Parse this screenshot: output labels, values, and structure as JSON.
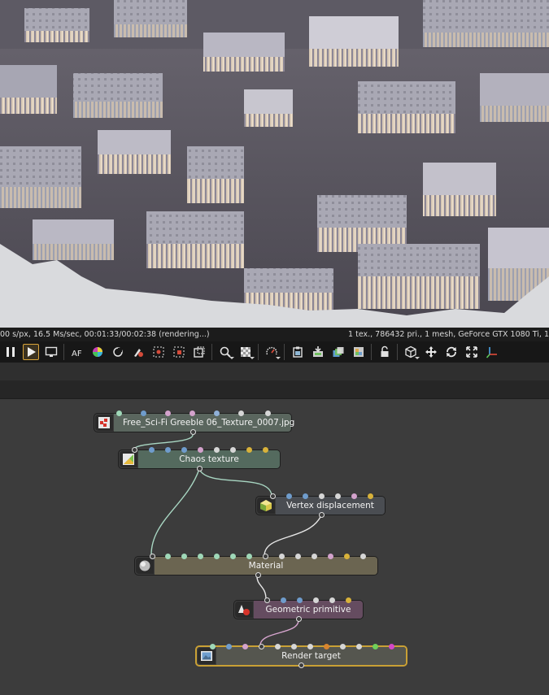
{
  "status": {
    "left": "00 s/px, 16.5 Ms/sec, 00:01:33/00:02:38 (rendering...)",
    "right": "1 tex., 786432 pri., 1 mesh, GeForce GTX 1080 Ti, 1"
  },
  "toolbar": {
    "buttons": [
      {
        "name": "pause-icon"
      },
      {
        "name": "play-icon",
        "active": true
      },
      {
        "name": "monitor-icon"
      },
      {
        "name": "af-focus-icon",
        "label": "AF"
      },
      {
        "name": "color-wheel-icon"
      },
      {
        "name": "white-balance-icon"
      },
      {
        "name": "material-picker-icon"
      },
      {
        "name": "object-picker-icon"
      },
      {
        "name": "camera-target-icon"
      },
      {
        "name": "region-render-icon"
      },
      {
        "name": "zoom-region-icon"
      },
      {
        "name": "film-region-icon"
      },
      {
        "name": "render-priority-icon"
      },
      {
        "name": "copy-to-clipboard-icon"
      },
      {
        "name": "save-render-icon"
      },
      {
        "name": "export-passes-icon"
      },
      {
        "name": "gallery-icon"
      },
      {
        "name": "lock-icon"
      },
      {
        "name": "viewport-cube-icon"
      },
      {
        "name": "move-icon"
      },
      {
        "name": "rotate-icon"
      },
      {
        "name": "fit-view-icon"
      },
      {
        "name": "axis-gizmo-icon"
      }
    ]
  },
  "nodes": {
    "image_texture": {
      "label": "Free_Sci-Fi Greeble 06_Texture_0007.jpg",
      "color": "#5a665e"
    },
    "chaos_texture": {
      "label": "Chaos texture",
      "color": "#546a5e"
    },
    "vertex_displacement": {
      "label": "Vertex displacement",
      "color": "#4a4d52"
    },
    "material": {
      "label": "Material",
      "color": "#6b6551"
    },
    "geometric_primitive": {
      "label": "Geometric primitive",
      "color": "#654c60"
    },
    "render_target": {
      "label": "Render target",
      "color": "#55564f"
    }
  },
  "colors": {
    "accent_selected": "#c9a035",
    "graph_background": "#3c3c3c",
    "wire_texture": "#a8d6c2",
    "wire_geometry": "#d8a6d0",
    "wire_default": "#e6e6e6"
  }
}
